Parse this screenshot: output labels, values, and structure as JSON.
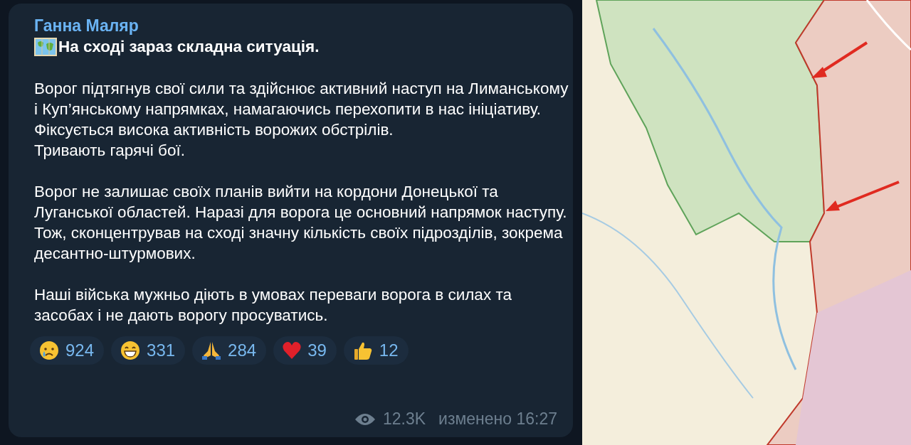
{
  "message": {
    "author": "Ганна Маляр",
    "title": "На сході зараз складна ситуація.",
    "paragraphs": [
      [
        "Ворог підтягнув свої сили та здійснює активний наступ на Лиманському і Куп’янському напрямках, намагаючись перехопити в нас ініціативу.",
        "Фіксується висока активність ворожих обстрілів.",
        "Тривають гарячі бої."
      ],
      [
        "Ворог не залишає своїх планів вийти на кордони Донецької та Луганської областей. Наразі для ворога це основний напрямок наступу. Тож, сконцентрував на сході значну кількість своїх підрозділів, зокрема десантно-штурмових."
      ],
      [
        "Наші війська мужньо діють в умовах переваги ворога в силах та засобах і не дають ворогу просуватись."
      ]
    ],
    "reactions": [
      {
        "kind": "cry",
        "count": "924"
      },
      {
        "kind": "grin",
        "count": "331"
      },
      {
        "kind": "pray",
        "count": "284"
      },
      {
        "kind": "heart",
        "count": "39"
      },
      {
        "kind": "thumbs",
        "count": "12"
      }
    ],
    "views": "12.3K",
    "edited": "изменено 16:27"
  }
}
